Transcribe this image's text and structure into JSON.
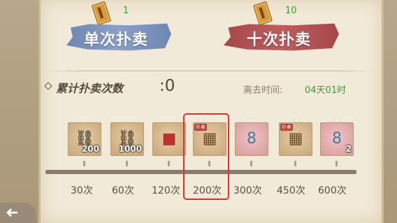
{
  "single": {
    "count": "1",
    "label": "单次扑卖",
    "ticket_icon": "ticket-icon"
  },
  "ten": {
    "count": "10",
    "label": "十次扑卖",
    "ticket_icon": "ticket-icon"
  },
  "cumulative": {
    "label": "累计扑卖次数",
    "separator": ":",
    "value": "0"
  },
  "leave": {
    "label": "离去时间:",
    "value": "04天01时"
  },
  "rewards": [
    {
      "icon": "silver-ingot-chain-icon",
      "qty": "200",
      "milestone": "30次"
    },
    {
      "icon": "silver-ingot-chain-icon",
      "qty": "1000",
      "milestone": "60次"
    },
    {
      "icon": "red-gift-box-icon",
      "qty": "",
      "milestone": "120次"
    },
    {
      "icon": "treasure-chest-icon",
      "qty": "",
      "milestone": "200次"
    },
    {
      "icon": "gourd-pouch-icon",
      "qty": "",
      "milestone": "300次"
    },
    {
      "icon": "treasure-chest-icon",
      "qty": "",
      "milestone": "450次"
    },
    {
      "icon": "gourd-pouch-icon",
      "qty": "2",
      "milestone": "600次"
    }
  ],
  "badge_text": "扑卖",
  "progress": 0,
  "colors": {
    "green": "#3f9a36",
    "blue_brush": "#7a90bd",
    "red_brush": "#b85353",
    "highlight": "#e0302c"
  }
}
